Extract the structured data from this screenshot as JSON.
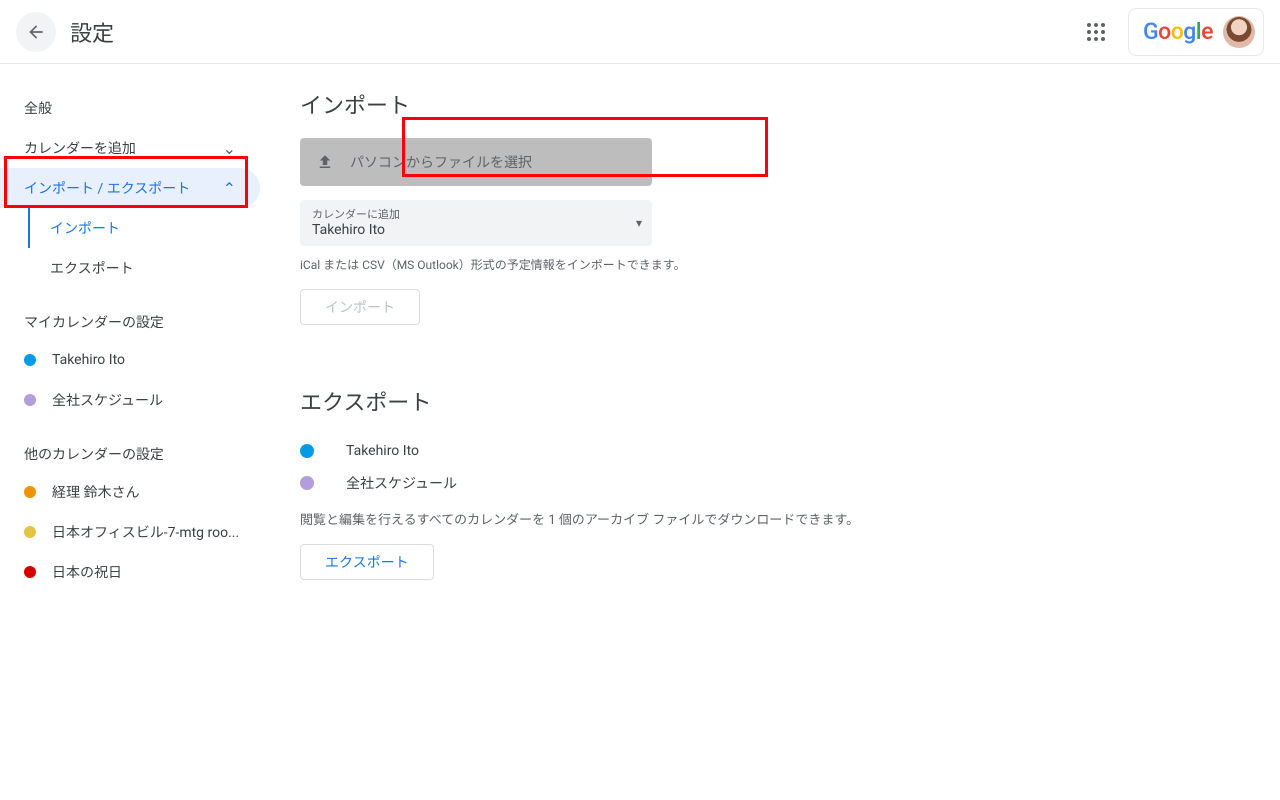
{
  "header": {
    "title": "設定",
    "brand": "Google"
  },
  "sidebar": {
    "general": "全般",
    "addCalendar": "カレンダーを追加",
    "importExport": "インポート / エクスポート",
    "sub": {
      "import": "インポート",
      "export": "エクスポート"
    },
    "myCalHeader": "マイカレンダーの設定",
    "myCals": [
      {
        "label": "Takehiro Ito",
        "color": "#039be5"
      },
      {
        "label": "全社スケジュール",
        "color": "#b39ddb"
      }
    ],
    "otherCalHeader": "他のカレンダーの設定",
    "otherCals": [
      {
        "label": "経理 鈴木さん",
        "color": "#f09300"
      },
      {
        "label": "日本オフィスビル-7-mtg roo...",
        "color": "#e4c441"
      },
      {
        "label": "日本の祝日",
        "color": "#d50000"
      }
    ]
  },
  "main": {
    "import": {
      "heading": "インポート",
      "pickFile": "パソコンからファイルを選択",
      "selectLabel": "カレンダーに追加",
      "selectValue": "Takehiro Ito",
      "hint": "iCal または CSV（MS Outlook）形式の予定情報をインポートできます。",
      "button": "インポート"
    },
    "export": {
      "heading": "エクスポート",
      "cals": [
        {
          "label": "Takehiro Ito",
          "color": "#039be5"
        },
        {
          "label": "全社スケジュール",
          "color": "#b39ddb"
        }
      ],
      "hint": "閲覧と編集を行えるすべてのカレンダーを 1 個のアーカイブ ファイルでダウンロードできます。",
      "button": "エクスポート"
    }
  }
}
